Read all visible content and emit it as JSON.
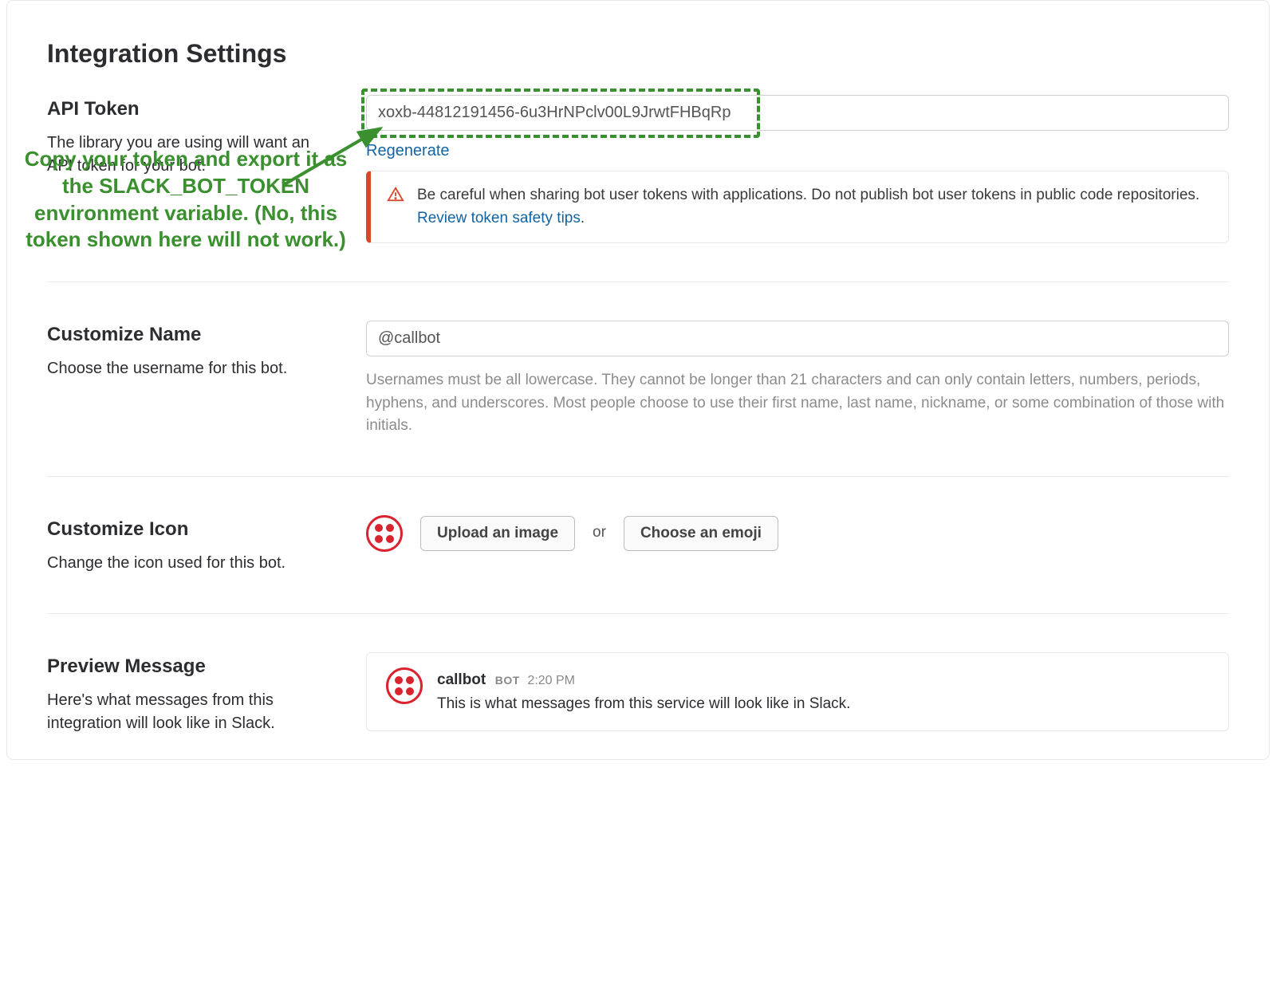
{
  "page_title": "Integration Settings",
  "api_token": {
    "title": "API Token",
    "description": "The library you are using will want an API token for your bot.",
    "value": "xoxb-44812191456-6u3HrNPclv00L9JrwtFHBqRp",
    "regenerate_label": "Regenerate",
    "warning_text_prefix": "Be careful when sharing bot user tokens with applications. Do not publish bot user tokens in public code repositories. ",
    "warning_link": "Review token safety tips",
    "warning_text_suffix": "."
  },
  "annotation_text": "Copy your token and export it as the SLACK_BOT_TOKEN environment variable. (No, this token shown here will not work.)",
  "customize_name": {
    "title": "Customize Name",
    "description": "Choose the username for this bot.",
    "value": "@callbot",
    "help_text": "Usernames must be all lowercase. They cannot be longer than 21 characters and can only contain letters, numbers, periods, hyphens, and underscores. Most people choose to use their first name, last name, nickname, or some combination of those with initials."
  },
  "customize_icon": {
    "title": "Customize Icon",
    "description": "Change the icon used for this bot.",
    "upload_label": "Upload an image",
    "or_label": "or",
    "emoji_label": "Choose an emoji"
  },
  "preview": {
    "title": "Preview Message",
    "description": "Here's what messages from this integration will look like in Slack.",
    "bot_name": "callbot",
    "badge": "BOT",
    "time": "2:20 PM",
    "message": "This is what messages from this service will look like in Slack."
  }
}
